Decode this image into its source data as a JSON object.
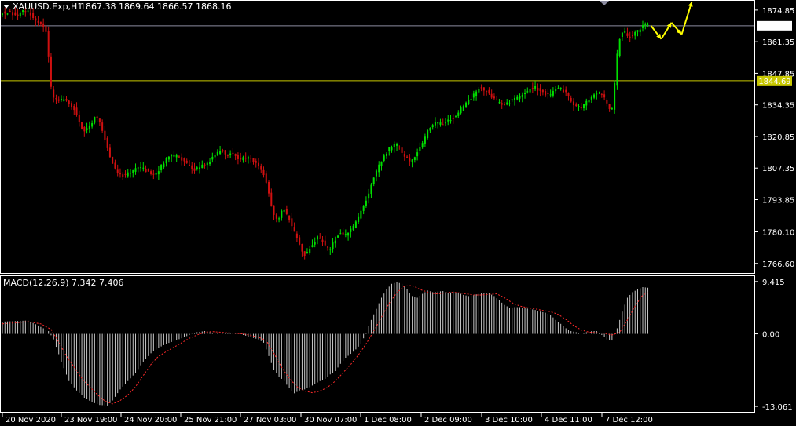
{
  "header": {
    "symbol_line": "XAUUSD.Exp,H1",
    "ohlc": "1867.38 1869.64 1866.57 1868.16"
  },
  "indicator": {
    "title": "MACD(12,26,9) 7.342 7.406"
  },
  "colors": {
    "background": "#000000",
    "bull": "#00e000",
    "bear": "#d01010",
    "signal": "#ff2a2a",
    "hist": "#c8c8c8",
    "hline": "#c8c800",
    "price_line": "#8c8ca0",
    "arrow": "#ffff00",
    "frame": "#ffffff",
    "text": "#ffffff"
  },
  "chart_data": [
    {
      "type": "candlestick",
      "title": "XAUUSD.Exp,H1",
      "y_ticks": [
        "1874.85",
        "1861.35",
        "1847.85",
        "1834.35",
        "1820.85",
        "1807.35",
        "1793.85",
        "1780.10",
        "1766.60"
      ],
      "y_tick_values": [
        1874.85,
        1861.35,
        1847.85,
        1834.35,
        1820.85,
        1807.35,
        1793.85,
        1780.1,
        1766.6
      ],
      "x_ticks": [
        "20 Nov 2020",
        "23 Nov 19:00",
        "24 Nov 20:00",
        "25 Nov 21:00",
        "27 Nov 03:00",
        "30 Nov 07:00",
        "1 Dec 08:00",
        "2 Dec 09:00",
        "3 Dec 10:00",
        "4 Dec 11:00",
        "7 Dec 12:00"
      ],
      "ylim": [
        1762.5,
        1878.5
      ],
      "current_price": {
        "value": 1868.16,
        "label": "1868.16"
      },
      "horizontal_line": {
        "value": 1844.69,
        "label": "1844.69"
      },
      "price_path": [
        [
          0,
          1873.5
        ],
        [
          3,
          1874
        ],
        [
          6,
          1872.5
        ],
        [
          9,
          1875
        ],
        [
          11,
          1874
        ],
        [
          13,
          1871
        ],
        [
          15,
          1869
        ],
        [
          17,
          1867
        ],
        [
          18,
          1864
        ],
        [
          19,
          1845
        ],
        [
          20,
          1838
        ],
        [
          22,
          1836
        ],
        [
          25,
          1837
        ],
        [
          27,
          1834
        ],
        [
          29,
          1832
        ],
        [
          32,
          1823
        ],
        [
          35,
          1826
        ],
        [
          37,
          1830
        ],
        [
          39,
          1825
        ],
        [
          41,
          1818
        ],
        [
          43,
          1810
        ],
        [
          45,
          1806
        ],
        [
          48,
          1804
        ],
        [
          51,
          1806
        ],
        [
          54,
          1808
        ],
        [
          57,
          1806
        ],
        [
          60,
          1804
        ],
        [
          63,
          1809
        ],
        [
          66,
          1813
        ],
        [
          69,
          1812
        ],
        [
          72,
          1810
        ],
        [
          75,
          1806
        ],
        [
          78,
          1808
        ],
        [
          81,
          1810
        ],
        [
          84,
          1813
        ],
        [
          86,
          1815
        ],
        [
          88,
          1813
        ],
        [
          90,
          1814
        ],
        [
          93,
          1811
        ],
        [
          96,
          1812
        ],
        [
          99,
          1810
        ],
        [
          102,
          1806
        ],
        [
          104,
          1800
        ],
        [
          106,
          1788
        ],
        [
          108,
          1785
        ],
        [
          110,
          1790
        ],
        [
          112,
          1787
        ],
        [
          114,
          1781
        ],
        [
          116,
          1776
        ],
        [
          118,
          1770
        ],
        [
          120,
          1772
        ],
        [
          122,
          1776
        ],
        [
          124,
          1778
        ],
        [
          126,
          1775
        ],
        [
          128,
          1772
        ],
        [
          130,
          1776
        ],
        [
          132,
          1780
        ],
        [
          134,
          1778
        ],
        [
          136,
          1780
        ],
        [
          139,
          1785
        ],
        [
          142,
          1792
        ],
        [
          145,
          1802
        ],
        [
          148,
          1810
        ],
        [
          151,
          1815
        ],
        [
          154,
          1818
        ],
        [
          157,
          1813
        ],
        [
          160,
          1810
        ],
        [
          163,
          1815
        ],
        [
          166,
          1822
        ],
        [
          169,
          1827
        ],
        [
          172,
          1826
        ],
        [
          175,
          1828
        ],
        [
          178,
          1830
        ],
        [
          181,
          1835
        ],
        [
          184,
          1838
        ],
        [
          187,
          1842
        ],
        [
          190,
          1840
        ],
        [
          193,
          1836
        ],
        [
          196,
          1834
        ],
        [
          199,
          1836
        ],
        [
          202,
          1838
        ],
        [
          205,
          1840
        ],
        [
          208,
          1842
        ],
        [
          211,
          1840
        ],
        [
          214,
          1838
        ],
        [
          217,
          1842
        ],
        [
          220,
          1840
        ],
        [
          223,
          1835
        ],
        [
          226,
          1833
        ],
        [
          229,
          1836
        ],
        [
          232,
          1840
        ],
        [
          235,
          1838
        ],
        [
          237,
          1834
        ],
        [
          238,
          1830
        ],
        [
          239,
          1836
        ],
        [
          240,
          1850
        ],
        [
          241,
          1862
        ],
        [
          243,
          1866
        ],
        [
          245,
          1863
        ],
        [
          247,
          1865
        ],
        [
          249,
          1866
        ],
        [
          251,
          1869
        ]
      ],
      "projection_arrows": [
        [
          1868.16,
          1862.5
        ],
        [
          1862.5,
          1869.5
        ],
        [
          1869.5,
          1864.5
        ],
        [
          1864.5,
          1878.5
        ]
      ]
    },
    {
      "type": "histogram",
      "title": "MACD(12,26,9) 7.342 7.406",
      "y_ticks": [
        "9.415",
        "0.00",
        "-13.061"
      ],
      "y_tick_values": [
        9.415,
        0.0,
        -13.061
      ],
      "ylim": [
        -13.9,
        10.1
      ],
      "macd_path": [
        [
          0,
          2.2
        ],
        [
          10,
          2.4
        ],
        [
          14,
          1.5
        ],
        [
          18,
          0.5
        ],
        [
          20,
          -1.0
        ],
        [
          23,
          -5.0
        ],
        [
          26,
          -8.5
        ],
        [
          29,
          -10.2
        ],
        [
          32,
          -11.5
        ],
        [
          35,
          -12.3
        ],
        [
          38,
          -12.8
        ],
        [
          41,
          -12.9
        ],
        [
          43,
          -12.0
        ],
        [
          46,
          -10.0
        ],
        [
          49,
          -8.5
        ],
        [
          52,
          -7.0
        ],
        [
          55,
          -5.0
        ],
        [
          58,
          -3.5
        ],
        [
          61,
          -2.5
        ],
        [
          64,
          -1.8
        ],
        [
          67,
          -1.3
        ],
        [
          70,
          -0.8
        ],
        [
          73,
          -0.2
        ],
        [
          76,
          0.3
        ],
        [
          79,
          0.5
        ],
        [
          82,
          0.2
        ],
        [
          85,
          0
        ],
        [
          88,
          0.1
        ],
        [
          91,
          0.2
        ],
        [
          94,
          -0.2
        ],
        [
          97,
          -0.6
        ],
        [
          100,
          -1.0
        ],
        [
          102,
          -1.6
        ],
        [
          104,
          -4.0
        ],
        [
          106,
          -6.5
        ],
        [
          108,
          -7.7
        ],
        [
          110,
          -8.5
        ],
        [
          112,
          -9.8
        ],
        [
          114,
          -10.7
        ],
        [
          116,
          -10.2
        ],
        [
          118,
          -10.0
        ],
        [
          120,
          -9.6
        ],
        [
          122,
          -9.0
        ],
        [
          124,
          -8.5
        ],
        [
          126,
          -8.1
        ],
        [
          128,
          -7.3
        ],
        [
          130,
          -6.7
        ],
        [
          132,
          -5.4
        ],
        [
          134,
          -4.3
        ],
        [
          136,
          -3.6
        ],
        [
          138,
          -2.8
        ],
        [
          140,
          -1.8
        ],
        [
          142,
          0.2
        ],
        [
          144,
          2.5
        ],
        [
          146,
          4.5
        ],
        [
          148,
          6.5
        ],
        [
          150,
          8.0
        ],
        [
          152,
          9.0
        ],
        [
          154,
          9.3
        ],
        [
          156,
          9.0
        ],
        [
          158,
          8.0
        ],
        [
          160,
          6.8
        ],
        [
          162,
          6.5
        ],
        [
          164,
          7.2
        ],
        [
          166,
          7.8
        ],
        [
          168,
          7.5
        ],
        [
          170,
          7.6
        ],
        [
          172,
          7.7
        ],
        [
          174,
          7.3
        ],
        [
          176,
          7.6
        ],
        [
          178,
          7.4
        ],
        [
          180,
          7.0
        ],
        [
          182,
          6.8
        ],
        [
          184,
          7.0
        ],
        [
          186,
          7.2
        ],
        [
          188,
          7.4
        ],
        [
          190,
          7.3
        ],
        [
          192,
          6.8
        ],
        [
          194,
          6.0
        ],
        [
          196,
          5.2
        ],
        [
          198,
          4.7
        ],
        [
          200,
          4.8
        ],
        [
          202,
          4.8
        ],
        [
          204,
          4.6
        ],
        [
          206,
          4.5
        ],
        [
          208,
          4.3
        ],
        [
          210,
          4.0
        ],
        [
          212,
          3.8
        ],
        [
          214,
          3.4
        ],
        [
          216,
          2.5
        ],
        [
          218,
          1.8
        ],
        [
          220,
          1.0
        ],
        [
          222,
          0.5
        ],
        [
          224,
          0.3
        ],
        [
          226,
          0.0
        ],
        [
          228,
          0.3
        ],
        [
          230,
          0.5
        ],
        [
          232,
          0.5
        ],
        [
          234,
          -0.2
        ],
        [
          236,
          -1.0
        ],
        [
          238,
          -1.2
        ],
        [
          240,
          1.0
        ],
        [
          242,
          4.0
        ],
        [
          244,
          6.5
        ],
        [
          246,
          7.5
        ],
        [
          248,
          8.0
        ],
        [
          250,
          8.4
        ],
        [
          252,
          8.3
        ]
      ],
      "signal_path": [
        [
          0,
          1.8
        ],
        [
          10,
          2.2
        ],
        [
          15,
          1.8
        ],
        [
          19,
          0.8
        ],
        [
          22,
          -1.5
        ],
        [
          25,
          -4.0
        ],
        [
          28,
          -6.0
        ],
        [
          31,
          -8.0
        ],
        [
          34,
          -9.5
        ],
        [
          37,
          -10.9
        ],
        [
          40,
          -12.1
        ],
        [
          43,
          -12.6
        ],
        [
          46,
          -12.0
        ],
        [
          49,
          -11.0
        ],
        [
          52,
          -9.5
        ],
        [
          55,
          -7.5
        ],
        [
          58,
          -5.5
        ],
        [
          61,
          -4.0
        ],
        [
          64,
          -3.2
        ],
        [
          67,
          -2.4
        ],
        [
          70,
          -1.6
        ],
        [
          73,
          -0.8
        ],
        [
          76,
          -0.2
        ],
        [
          79,
          0.3
        ],
        [
          82,
          0.4
        ],
        [
          85,
          0.3
        ],
        [
          88,
          0.2
        ],
        [
          91,
          0.1
        ],
        [
          94,
          0
        ],
        [
          97,
          -0.3
        ],
        [
          100,
          -0.6
        ],
        [
          103,
          -1.2
        ],
        [
          106,
          -3.5
        ],
        [
          109,
          -6.0
        ],
        [
          112,
          -8.0
        ],
        [
          115,
          -9.5
        ],
        [
          118,
          -10.3
        ],
        [
          121,
          -10.6
        ],
        [
          124,
          -10.3
        ],
        [
          127,
          -9.6
        ],
        [
          130,
          -8.5
        ],
        [
          133,
          -7.0
        ],
        [
          136,
          -5.5
        ],
        [
          139,
          -3.8
        ],
        [
          142,
          -1.8
        ],
        [
          145,
          0.5
        ],
        [
          148,
          3.0
        ],
        [
          151,
          5.5
        ],
        [
          154,
          7.4
        ],
        [
          157,
          8.6
        ],
        [
          160,
          8.7
        ],
        [
          163,
          8.0
        ],
        [
          166,
          7.5
        ],
        [
          169,
          7.2
        ],
        [
          172,
          7.3
        ],
        [
          175,
          7.5
        ],
        [
          178,
          7.4
        ],
        [
          181,
          7.2
        ],
        [
          184,
          7.0
        ],
        [
          187,
          7.0
        ],
        [
          190,
          7.1
        ],
        [
          193,
          7.2
        ],
        [
          196,
          6.5
        ],
        [
          199,
          5.6
        ],
        [
          202,
          5.0
        ],
        [
          205,
          4.7
        ],
        [
          208,
          4.5
        ],
        [
          211,
          4.2
        ],
        [
          214,
          4.0
        ],
        [
          217,
          3.5
        ],
        [
          220,
          2.6
        ],
        [
          223,
          1.5
        ],
        [
          226,
          0.7
        ],
        [
          229,
          0.3
        ],
        [
          232,
          0.2
        ],
        [
          235,
          0.1
        ],
        [
          238,
          -0.2
        ],
        [
          241,
          0.3
        ],
        [
          244,
          2.5
        ],
        [
          247,
          5.0
        ],
        [
          250,
          7.0
        ],
        [
          252,
          7.4
        ]
      ]
    }
  ]
}
